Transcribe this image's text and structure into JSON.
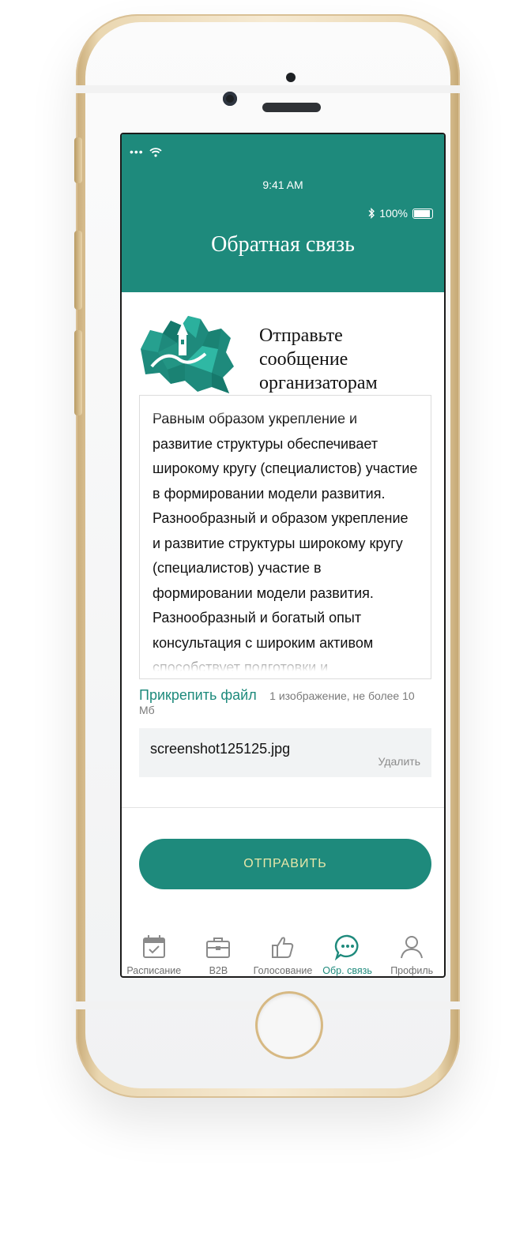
{
  "status_bar": {
    "signal": "•••",
    "time": "9:41 AM",
    "bluetooth_icon": "bluetooth-icon",
    "battery": "100%"
  },
  "header": {
    "title": "Обратная связь"
  },
  "hero": {
    "icon": "russia-map-icon",
    "text": "Отправьте сообщение организаторам саммита"
  },
  "message": {
    "text": "Равным образом укрепление и развитие структуры обеспечивает широкому кругу (специалистов) участие в формировании модели развития. Разнообразный и образом укрепление и развитие структуры широкому кругу (специалистов) участие в формировании модели развития. Разнообразный и богатый опыт консультация с широким активом способствует подготовки и реализациибогатый опыт консультация с широким активом способствует подготовки и реализации"
  },
  "attachment": {
    "link_label": "Прикрепить файл",
    "hint": "1 изображение, не более 10 Мб",
    "file_name": "screenshot125125.jpg",
    "delete_label": "Удалить"
  },
  "submit": {
    "label": "ОТПРАВИТЬ"
  },
  "tabs": [
    {
      "label": "Расписание",
      "icon": "calendar-icon",
      "active": false
    },
    {
      "label": "B2B",
      "icon": "briefcase-icon",
      "active": false
    },
    {
      "label": "Голосование",
      "icon": "thumbs-up-icon",
      "active": false
    },
    {
      "label": "Обр. связь",
      "icon": "chat-bubble-icon",
      "active": true
    },
    {
      "label": "Профиль",
      "icon": "person-icon",
      "active": false
    }
  ],
  "colors": {
    "accent": "#1e8a7c",
    "button_text": "#e8e7a9",
    "phone_gold": "#ead7b1"
  }
}
